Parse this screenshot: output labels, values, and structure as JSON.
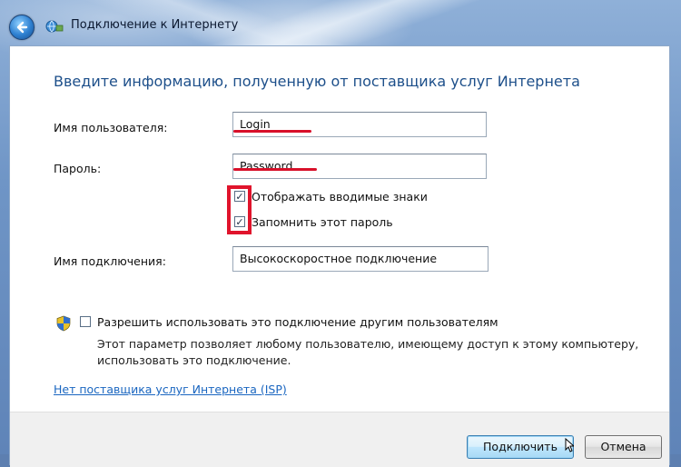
{
  "window": {
    "title": "Подключение к Интернету"
  },
  "heading": "Введите информацию, полученную от поставщика услуг Интернета",
  "form": {
    "username_label": "Имя пользователя:",
    "username_value": "Login",
    "password_label": "Пароль:",
    "password_value": "Password",
    "show_chars_label": "Отображать вводимые знаки",
    "show_chars_checked": true,
    "remember_label": "Запомнить этот пароль",
    "remember_checked": true,
    "connection_name_label": "Имя подключения:",
    "connection_name_value": "Высокоскоростное подключение"
  },
  "share": {
    "label": "Разрешить использовать это подключение другим пользователям",
    "checked": false,
    "description_line1": "Этот параметр позволяет любому пользователю, имеющему доступ к этому компьютеру,",
    "description_line2": "использовать это подключение."
  },
  "isp_link": "Нет поставщика услуг Интернета (ISP)",
  "buttons": {
    "connect": "Подключить",
    "cancel": "Отмена"
  },
  "colors": {
    "accent_heading": "#1d4f8a",
    "annotation_red": "#e0142c",
    "link": "#1a66c0"
  },
  "icons": {
    "back": "back-arrow-icon",
    "connection": "network-connection-icon",
    "uac": "uac-shield-icon"
  }
}
